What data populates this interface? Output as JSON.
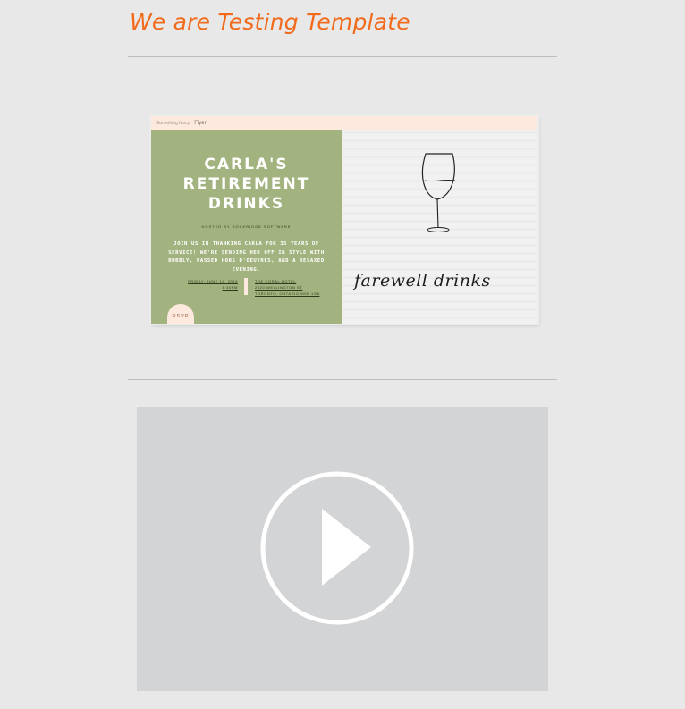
{
  "page": {
    "title": "We are Testing Template"
  },
  "invitation": {
    "topbar_small": "Something fancy",
    "topbar_brand": "Flyer",
    "title": "CARLA'S\nRETIREMENT\nDRINKS",
    "hosted_by": "HOSTED BY ROCKRIDGE SOFTWARE",
    "body": "JOIN US IN THANKING CARLA FOR 35 YEARS OF SERVICE! WE'RE SENDING HER OFF IN STYLE WITH BUBBLY, PASSED HORS D'OEUVRES, AND A RELAXED EVENING.",
    "date_line1": "FRIDAY, JUNE 14, 2019",
    "date_line2": "6:30PM",
    "venue_line1": "THE CORAL HOTEL",
    "venue_line2": "2820 WELLINGTON ST",
    "venue_line3": "TORONTO, ONTARIO M5B 1G8",
    "rsvp_label": "RSVP",
    "script_text": "farewell drinks",
    "icon": "wine-glass-icon"
  },
  "video": {
    "icon": "play-icon"
  },
  "colors": {
    "title": "#f26b1d",
    "card_green": "#a3b37f",
    "card_peach": "#fde9dd",
    "video_bg": "#d3d4d6"
  }
}
